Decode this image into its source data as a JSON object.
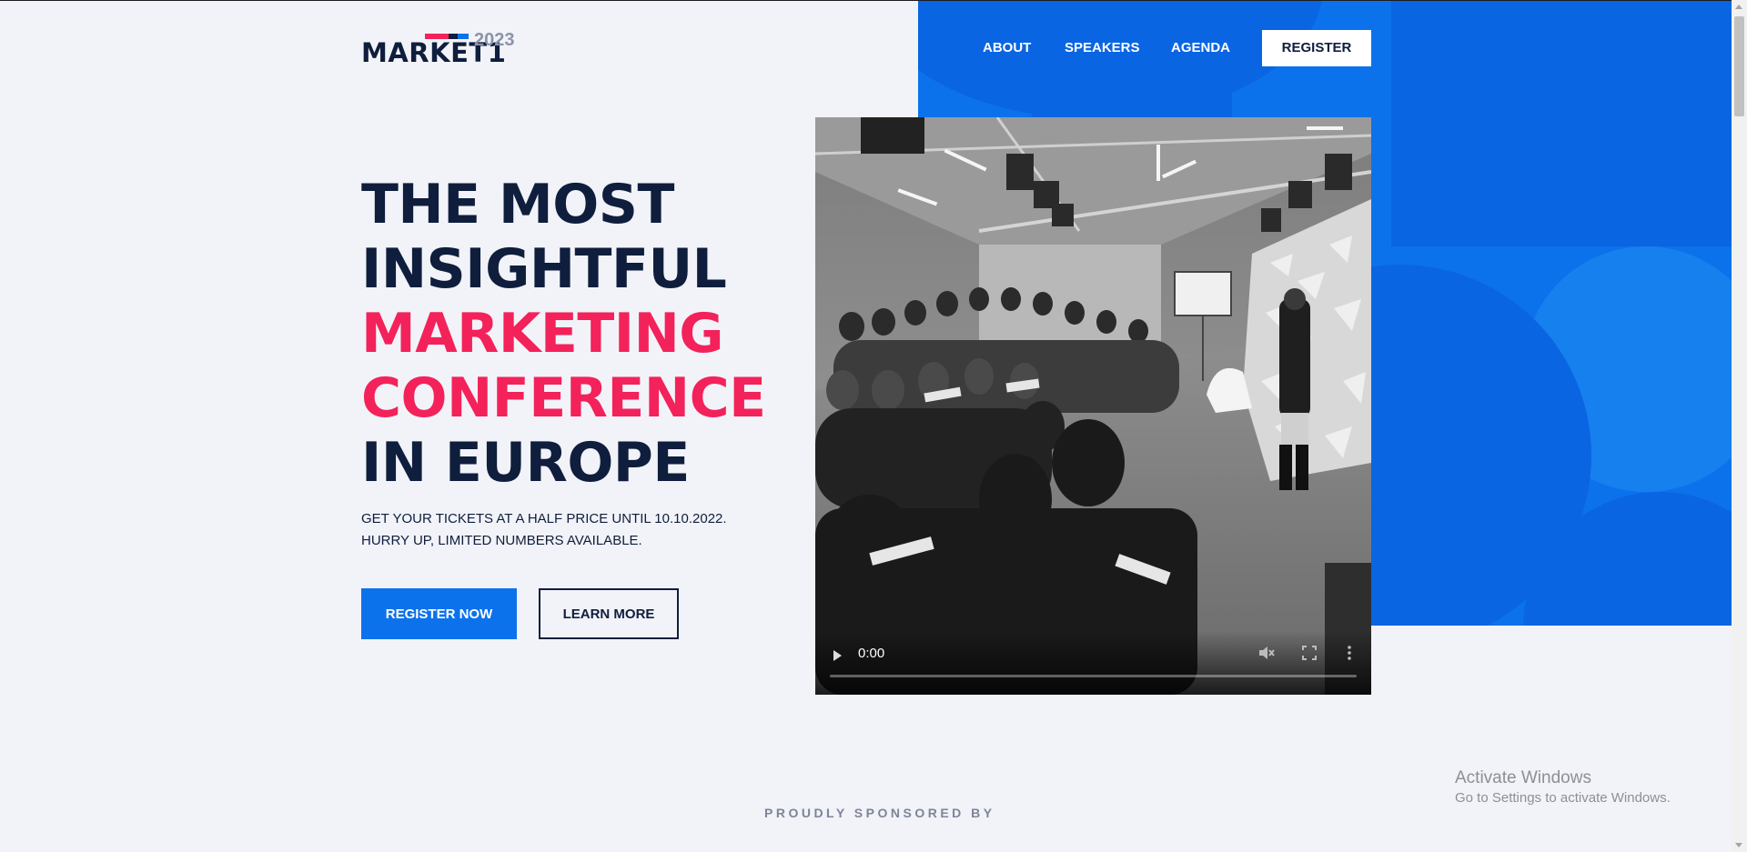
{
  "logo": {
    "text": "MARKET1",
    "year": "2023",
    "stripe_colors": [
      "#f3225a",
      "#0f1e3d",
      "#0c72ec"
    ]
  },
  "nav": {
    "items": [
      {
        "label": "ABOUT"
      },
      {
        "label": "SPEAKERS"
      },
      {
        "label": "AGENDA"
      }
    ],
    "register_label": "REGISTER"
  },
  "hero": {
    "title_lines": [
      "THE MOST",
      "INSIGHTFUL",
      "MARKETING",
      "CONFERENCE",
      "IN EUROPE"
    ],
    "subtitle_lines": [
      "GET YOUR TICKETS AT A HALF PRICE UNTIL 10.10.2022.",
      "HURRY UP, LIMITED NUMBERS AVAILABLE."
    ],
    "register_now_label": "REGISTER NOW",
    "learn_more_label": "LEARN MORE"
  },
  "video": {
    "time": "0:00",
    "icons": [
      "play-icon",
      "mute-icon",
      "fullscreen-icon",
      "more-icon"
    ]
  },
  "sponsors": {
    "heading": "PROUDLY SPONSORED BY"
  },
  "watermark": {
    "line1": "Activate Windows",
    "line2": "Go to Settings to activate Windows."
  },
  "colors": {
    "accent_blue": "#0c72ec",
    "accent_pink": "#f3225a",
    "navy": "#0f1e3d",
    "background": "#f2f3f8"
  }
}
